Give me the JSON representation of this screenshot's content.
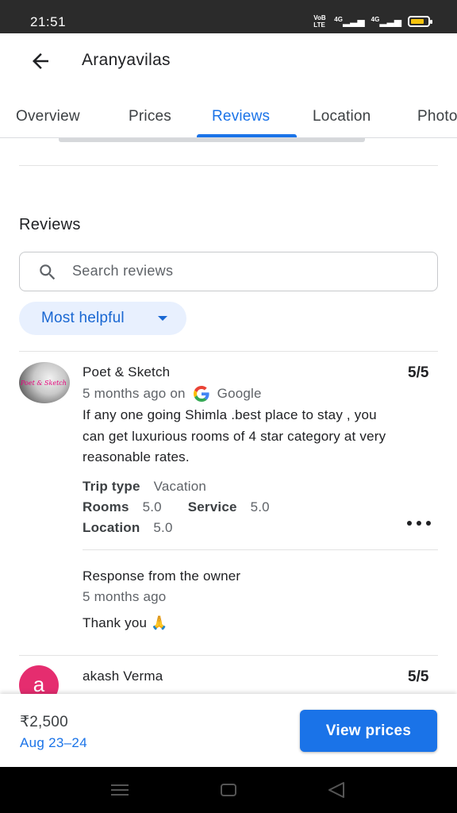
{
  "status_bar": {
    "time": "21:51",
    "volte": "VoB LTE",
    "signal1": "4G",
    "signal2": "4G",
    "battery_color": "#f4c20d"
  },
  "app_bar": {
    "back_icon": "arrow-left-icon",
    "title": "Aranyavilas"
  },
  "tabs": [
    {
      "label": "Overview",
      "active": false
    },
    {
      "label": "Prices",
      "active": false
    },
    {
      "label": "Reviews",
      "active": true
    },
    {
      "label": "Location",
      "active": false
    },
    {
      "label": "Photos",
      "active": false
    }
  ],
  "reviews_section": {
    "heading": "Reviews",
    "search_placeholder": "Search reviews",
    "sort_label": "Most helpful"
  },
  "reviews": [
    {
      "author": "Poet & Sketch",
      "avatar_text": "Poet & Sketch",
      "rating": "5/5",
      "time": "5 months ago on",
      "source": "Google",
      "text": "If any one going Shimla .best place to stay , you can get luxurious rooms of 4 star category at very reasonable rates.",
      "trip_type_label": "Trip type",
      "trip_type_value": "Vacation",
      "rooms_label": "Rooms",
      "rooms_value": "5.0",
      "service_label": "Service",
      "service_value": "5.0",
      "location_label": "Location",
      "location_value": "5.0",
      "owner_response_title": "Response from the owner",
      "owner_response_time": "5 months ago",
      "owner_response_text": "Thank you 🙏"
    },
    {
      "author": "akash Verma",
      "avatar_letter": "a",
      "avatar_color": "#e52d6f",
      "rating": "5/5"
    }
  ],
  "bottom_bar": {
    "price": "₹2,500",
    "dates": "Aug 23–24",
    "cta": "View prices"
  },
  "colors": {
    "accent": "#1a73e8",
    "chip_bg": "#e8f0fe"
  }
}
